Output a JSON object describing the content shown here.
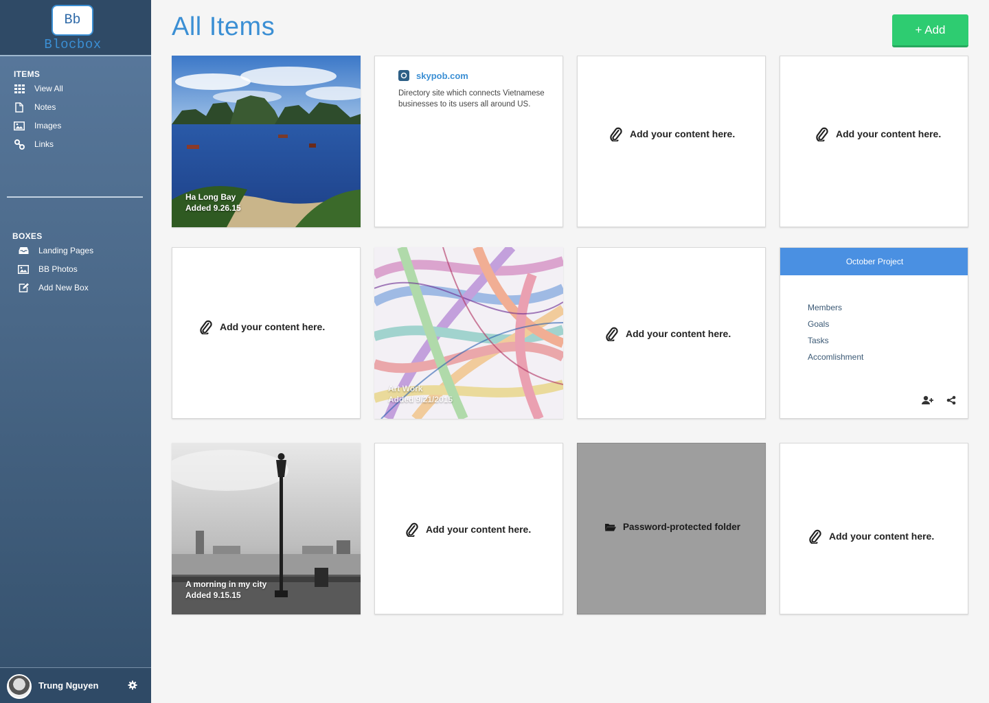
{
  "app": {
    "logo_mark": "Bb",
    "logo_name": "Blocbox"
  },
  "sidebar": {
    "items_heading": "ITEMS",
    "items": [
      {
        "label": "View All",
        "icon": "grid-icon"
      },
      {
        "label": "Notes",
        "icon": "document-icon"
      },
      {
        "label": "Images",
        "icon": "image-icon"
      },
      {
        "label": "Links",
        "icon": "link-icon"
      }
    ],
    "boxes_heading": "BOXES",
    "boxes": [
      {
        "label": "Landing Pages",
        "icon": "inbox-icon"
      },
      {
        "label": "BB Photos",
        "icon": "image-icon"
      },
      {
        "label": "Add New Box",
        "icon": "edit-icon"
      }
    ],
    "user": {
      "name": "Trung Nguyen"
    }
  },
  "header": {
    "title": "All Items",
    "add_label": "+ Add"
  },
  "cards": {
    "placeholder_text": "Add your content here.",
    "halong": {
      "title": "Ha Long Bay",
      "added": "Added 9.26.15"
    },
    "link": {
      "title": "skypob.com",
      "description": "Directory site which connects Vietnamese businesses to its users all around US."
    },
    "artwork": {
      "title": "Art Work",
      "added": "Added 9/21/2015"
    },
    "box": {
      "title": "October Project",
      "links": [
        "Members",
        "Goals",
        "Tasks",
        "Accomlishment"
      ]
    },
    "morning": {
      "title": "A morning in my city",
      "added": "Added 9.15.15"
    },
    "folder": {
      "label": "Password-protected folder"
    }
  },
  "colors": {
    "accent": "#3b8fd4",
    "add_button": "#2ecc71",
    "box_header": "#4a90e2",
    "sidebar_dark": "#2f4a66"
  }
}
